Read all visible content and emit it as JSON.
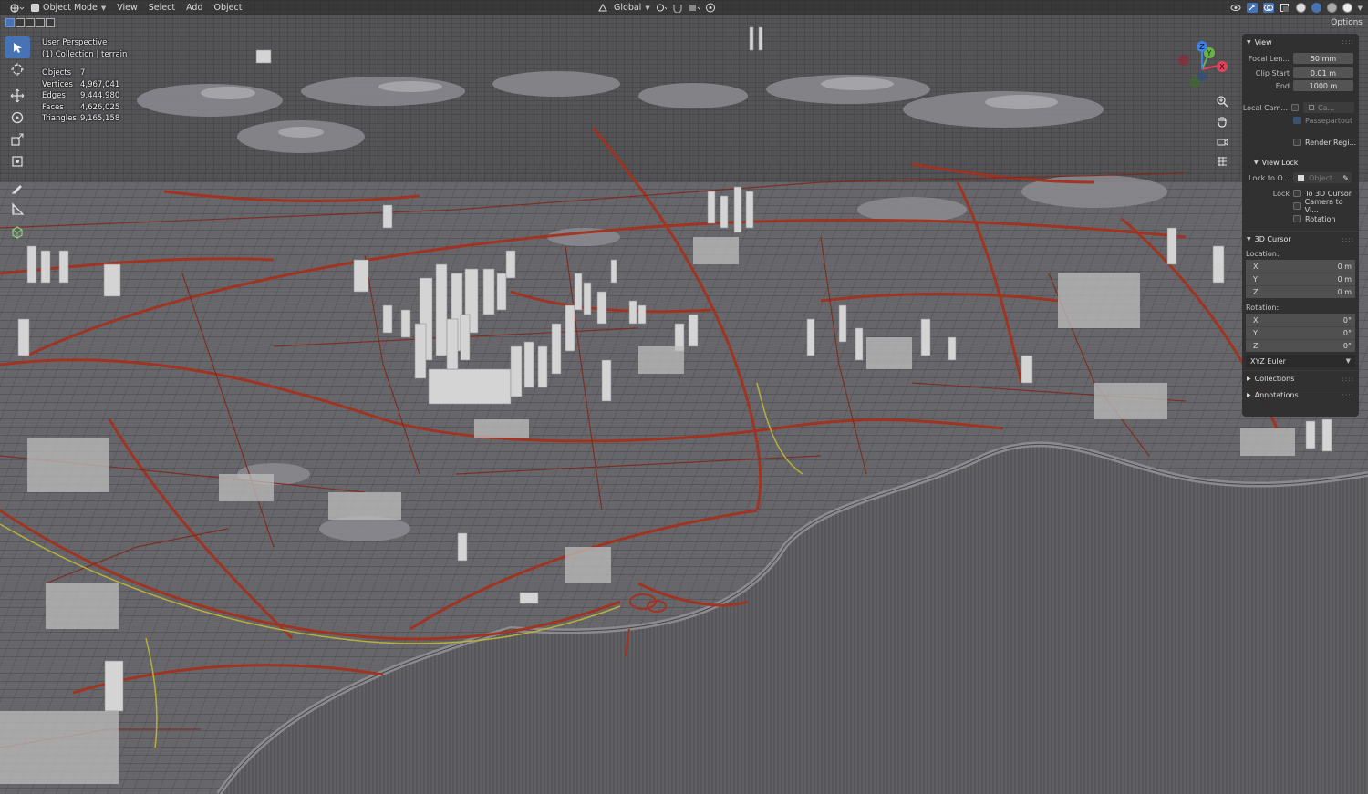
{
  "header": {
    "mode_label": "Object Mode",
    "menus": [
      "View",
      "Select",
      "Add",
      "Object"
    ],
    "transform_orientation": "Global"
  },
  "toolbar_options": "Options",
  "overlay": {
    "view_name": "User Perspective",
    "collection_label": "(1) Collection | terrain",
    "stats": [
      {
        "label": "Objects",
        "value": "7"
      },
      {
        "label": "Vertices",
        "value": "4,967,041"
      },
      {
        "label": "Edges",
        "value": "9,444,980"
      },
      {
        "label": "Faces",
        "value": "4,626,025"
      },
      {
        "label": "Triangles",
        "value": "9,165,158"
      }
    ]
  },
  "gizmo": {
    "x": "X",
    "y": "Y",
    "z": "Z"
  },
  "sidebar": {
    "view": {
      "title": "View",
      "focal_label": "Focal Len...",
      "focal_value": "50 mm",
      "clip_start_label": "Clip Start",
      "clip_start_value": "0.01 m",
      "end_label": "End",
      "end_value": "1000 m",
      "local_camera_label": "Local Cam...",
      "local_camera_value": "Ca...",
      "passepartout_label": "Passepartout",
      "render_region_label": "Render Regi..."
    },
    "view_lock": {
      "title": "View Lock",
      "lock_to_label": "Lock to O...",
      "lock_to_placeholder": "Object",
      "lock_label": "Lock",
      "to_3d_cursor": "To 3D Cursor",
      "camera_to_view": "Camera to Vi...",
      "rotation": "Rotation"
    },
    "cursor": {
      "title": "3D Cursor",
      "location_label": "Location:",
      "location": [
        {
          "axis": "X",
          "value": "0 m"
        },
        {
          "axis": "Y",
          "value": "0 m"
        },
        {
          "axis": "Z",
          "value": "0 m"
        }
      ],
      "rotation_label": "Rotation:",
      "rotation": [
        {
          "axis": "X",
          "value": "0°"
        },
        {
          "axis": "Y",
          "value": "0°"
        },
        {
          "axis": "Z",
          "value": "0°"
        }
      ],
      "rotation_mode": "XYZ Euler"
    },
    "collections_title": "Collections",
    "annotations_title": "Annotations"
  },
  "colors": {
    "accent": "#4772b3",
    "roads": "#a3321f",
    "terrain": "#6a6a6e",
    "buildings": "#d4d4d4",
    "highway_yellow": "#b7b03a",
    "gizmo_x": "#e0445a",
    "gizmo_y": "#6ab34a",
    "gizmo_z": "#3f7fe0"
  }
}
